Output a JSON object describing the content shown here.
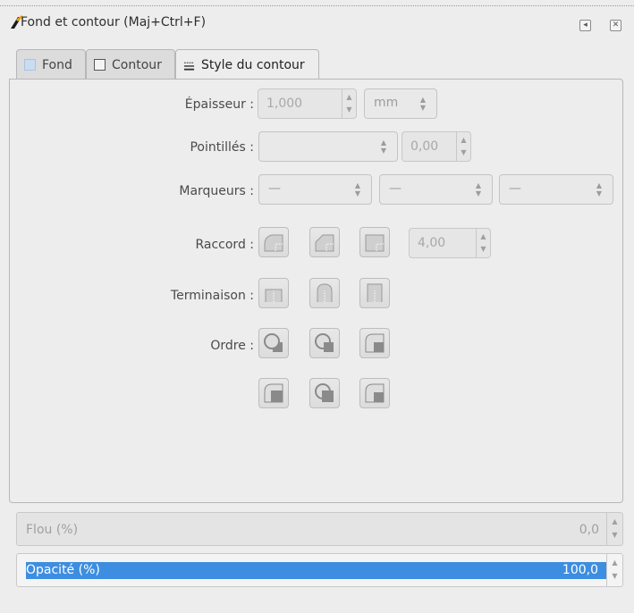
{
  "titlebar": {
    "title": "Fond et contour (Maj+Ctrl+F)",
    "app_icon": "fill-stroke-icon",
    "buttons": [
      {
        "icon": "collapse-left-icon",
        "glyph": "◂"
      },
      {
        "icon": "close-icon",
        "glyph": "✕"
      }
    ]
  },
  "tabs": [
    {
      "label": "Fond",
      "icon": "fill-square-icon",
      "active": false
    },
    {
      "label": "Contour",
      "icon": "stroke-square-icon",
      "active": false
    },
    {
      "label": "Style du contour",
      "icon": "stroke-style-icon",
      "active": true
    }
  ],
  "stroke_style": {
    "width": {
      "label": "Épaisseur :",
      "value": "1,000",
      "unit": "mm"
    },
    "dashes": {
      "label": "Pointillés :",
      "offset": "0,00"
    },
    "markers": {
      "label": "Marqueurs :",
      "start": "—",
      "mid": "—",
      "end": "—"
    },
    "join": {
      "label": "Raccord :",
      "miter_limit": "4,00",
      "icons": [
        "round-join-icon",
        "bevel-join-icon",
        "miter-join-icon"
      ]
    },
    "cap": {
      "label": "Terminaison :",
      "icons": [
        "butt-cap-icon",
        "round-cap-icon",
        "square-cap-icon"
      ]
    },
    "order": {
      "label": "Ordre :",
      "icons": [
        "fill-stroke-markers-icon",
        "stroke-fill-markers-icon",
        "fill-markers-stroke-icon",
        "markers-fill-stroke-icon",
        "stroke-markers-fill-icon",
        "markers-stroke-fill-icon"
      ]
    }
  },
  "blur": {
    "label": "Flou (%)",
    "value": "0,0"
  },
  "opacity": {
    "label": "Opacité (%)",
    "value": "100,0"
  },
  "colors": {
    "accent": "#3d8ee0",
    "background": "#ededed"
  }
}
